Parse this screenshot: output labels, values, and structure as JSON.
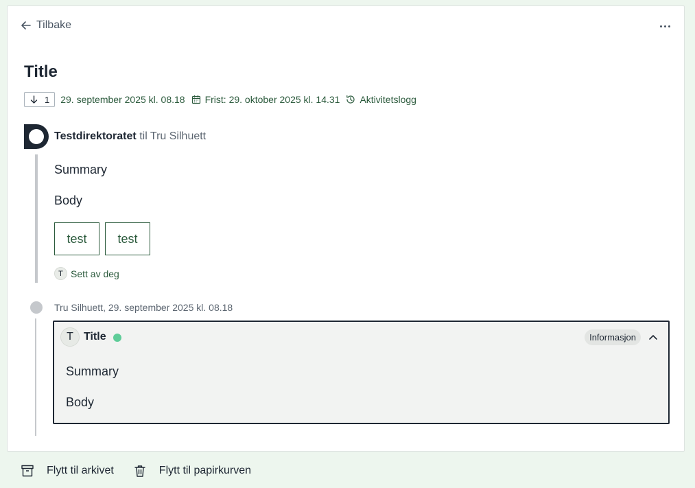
{
  "nav": {
    "back_label": "Tilbake",
    "more_icon": "more-horizontal-icon"
  },
  "message": {
    "title": "Title",
    "reply_count": "1",
    "date": "29. september 2025 kl. 08.18",
    "deadline": "Frist: 29. oktober 2025 kl. 14.31",
    "activity_log": "Aktivitetslogg"
  },
  "sender": {
    "name": "Testdirektoratet",
    "connector": "til",
    "recipient": "Tru Silhuett"
  },
  "content": {
    "summary": "Summary",
    "body": "Body",
    "attachments": [
      "test",
      "test"
    ],
    "seen_by_initial": "T",
    "seen_by_label": "Sett av deg"
  },
  "reply": {
    "meta": "Tru Silhuett, 29. september 2025 kl. 08.18",
    "avatar_initial": "T",
    "title": "Title",
    "tag": "Informasjon",
    "summary": "Summary",
    "body": "Body",
    "unread_color": "#5ecc98"
  },
  "actions": {
    "archive_label": "Flytt til arkivet",
    "trash_label": "Flytt til papirkurven"
  },
  "colors": {
    "accent": "#2b5a3c",
    "background": "#edf6ee",
    "text": "#1e2733"
  }
}
